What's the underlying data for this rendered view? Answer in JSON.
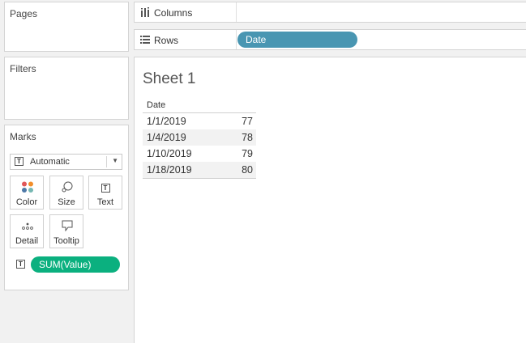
{
  "panels": {
    "pages": {
      "title": "Pages"
    },
    "filters": {
      "title": "Filters"
    },
    "marks": {
      "title": "Marks",
      "mark_type": "Automatic",
      "mark_type_icon": "text-mark-icon",
      "buttons": [
        {
          "label": "Color",
          "icon": "color-icon"
        },
        {
          "label": "Size",
          "icon": "size-icon"
        },
        {
          "label": "Text",
          "icon": "text-icon"
        },
        {
          "label": "Detail",
          "icon": "detail-icon"
        },
        {
          "label": "Tooltip",
          "icon": "tooltip-icon"
        }
      ],
      "fields": [
        {
          "label": "SUM(Value)",
          "encoding": "text",
          "color": "#0bb07f"
        }
      ]
    }
  },
  "shelves": {
    "columns": {
      "label": "Columns",
      "icon": "columns-icon",
      "pills": []
    },
    "rows": {
      "label": "Rows",
      "icon": "rows-icon",
      "pills": [
        {
          "label": "Date",
          "color": "#4996b2"
        }
      ]
    }
  },
  "sheet": {
    "title": "Sheet 1",
    "table": {
      "header": "Date",
      "rows": [
        {
          "date": "1/1/2019",
          "value": "77"
        },
        {
          "date": "1/4/2019",
          "value": "78"
        },
        {
          "date": "1/10/2019",
          "value": "79"
        },
        {
          "date": "1/18/2019",
          "value": "80"
        }
      ]
    }
  }
}
